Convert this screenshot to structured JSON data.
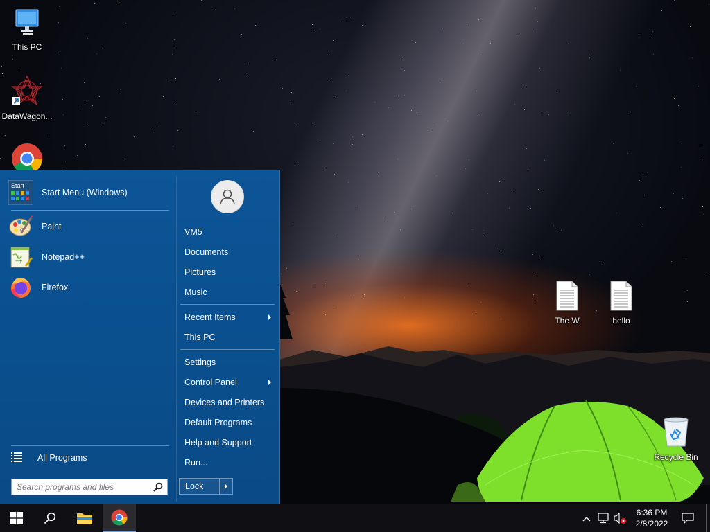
{
  "desktop": {
    "icons": [
      {
        "label": "This PC",
        "icon": "monitor-icon"
      },
      {
        "label": "DataWagon...",
        "icon": "datawagon-icon"
      },
      {
        "label": "",
        "icon": "chrome-icon"
      },
      {
        "label": "The W",
        "icon": "text-file-icon"
      },
      {
        "label": "hello",
        "icon": "text-file-icon"
      },
      {
        "label": "Recycle Bin",
        "icon": "recycle-bin-icon"
      }
    ]
  },
  "start_menu": {
    "pinned": [
      {
        "label": "Start Menu (Windows)",
        "icon": "start-menu-app-icon",
        "icon_text": "Start"
      },
      {
        "label": "Paint",
        "icon": "paint-icon"
      },
      {
        "label": "Notepad++",
        "icon": "notepadpp-icon"
      },
      {
        "label": "Firefox",
        "icon": "firefox-icon"
      }
    ],
    "all_programs_label": "All Programs",
    "search": {
      "placeholder": "Search programs and files",
      "value": ""
    },
    "user": {
      "avatar_icon": "user-icon"
    },
    "right_items": [
      {
        "label": "VM5"
      },
      {
        "label": "Documents"
      },
      {
        "label": "Pictures"
      },
      {
        "label": "Music"
      },
      {
        "label": "Recent Items",
        "submenu": true
      },
      {
        "label": "This PC"
      },
      {
        "label": "Settings"
      },
      {
        "label": "Control Panel",
        "submenu": true
      },
      {
        "label": "Devices and Printers"
      },
      {
        "label": "Default Programs"
      },
      {
        "label": "Help and Support"
      },
      {
        "label": "Run..."
      }
    ],
    "lock_label": "Lock"
  },
  "taskbar": {
    "buttons": [
      {
        "name": "start-button",
        "icon": "windows-logo-icon"
      },
      {
        "name": "search-button",
        "icon": "search-icon"
      },
      {
        "name": "file-explorer-button",
        "icon": "folder-icon"
      },
      {
        "name": "chrome-taskbar-button",
        "icon": "chrome-icon",
        "active": true
      }
    ],
    "tray": {
      "icons": [
        "chevron-up-icon",
        "network-icon",
        "volume-muted-icon"
      ],
      "time": "6:36 PM",
      "date": "2/8/2022",
      "notification_icon": "action-center-icon"
    }
  },
  "colors": {
    "start_menu_bg": "#0a4f8e",
    "taskbar_bg": "#101014",
    "tent_green": "#7ee02a"
  }
}
